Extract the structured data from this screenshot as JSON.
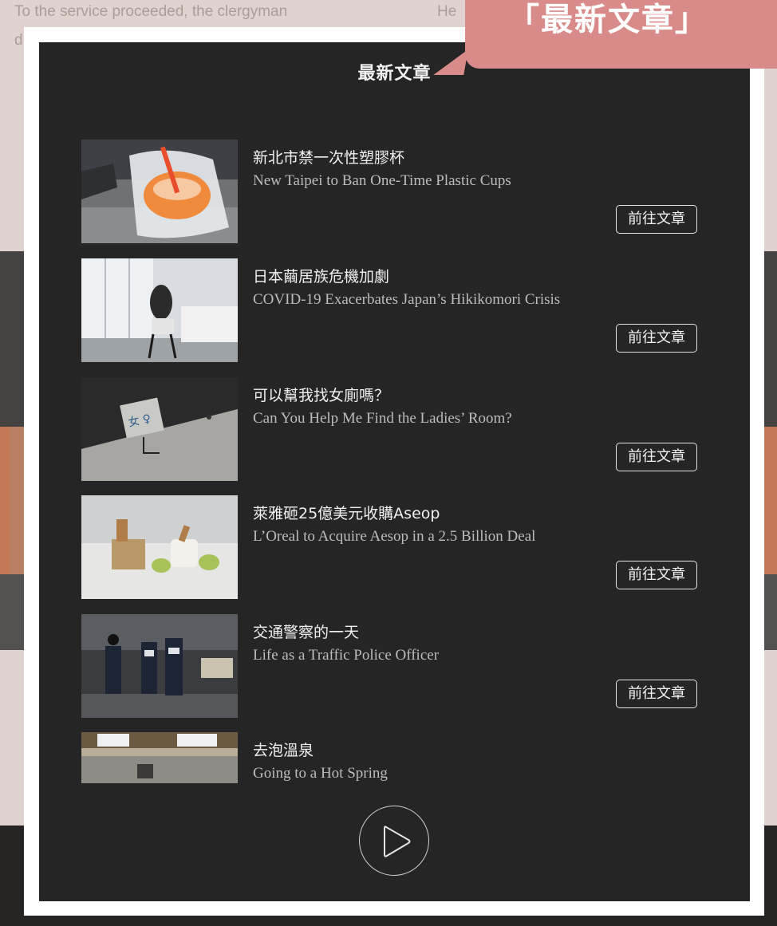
{
  "background": {
    "snippet_left": "To the service proceeded, the clergyman",
    "snippet_left2": "d",
    "snippet_right": "He"
  },
  "callout": {
    "text": "「最新文章」",
    "color": "#d98b8a"
  },
  "modal": {
    "title": "最新文章",
    "articles": [
      {
        "zh": "新北市禁一次性塑膠杯",
        "en": "New Taipei to Ban One-Time Plastic Cups",
        "button": "前往文章",
        "thumb": "plastic-cup-photo"
      },
      {
        "zh": "日本繭居族危機加劇",
        "en": "COVID-19 Exacerbates Japan’s Hikikomori Crisis",
        "button": "前往文章",
        "thumb": "woman-by-window-photo"
      },
      {
        "zh": "可以幫我找女廁嗎？",
        "en": "Can You Help Me Find the Ladies’ Room?",
        "button": "前往文章",
        "thumb": "restroom-sign-photo"
      },
      {
        "zh": "萊雅砸25億美元收購Aseop",
        "en": "L’Oreal to Acquire Aesop in a 2.5 Billion Deal",
        "button": "前往文章",
        "thumb": "cosmetics-photo"
      },
      {
        "zh": "交通警察的一天",
        "en": "Life as a Traffic Police Officer",
        "button": "前往文章",
        "thumb": "traffic-police-photo"
      },
      {
        "zh": "去泡溫泉",
        "en": "Going to a Hot Spring",
        "thumb": "hot-spring-photo"
      }
    ],
    "play_icon": "play-icon"
  },
  "colors": {
    "modal_bg": "#252525",
    "frame": "#ffffff",
    "page_bg": "#f3e4e0"
  }
}
